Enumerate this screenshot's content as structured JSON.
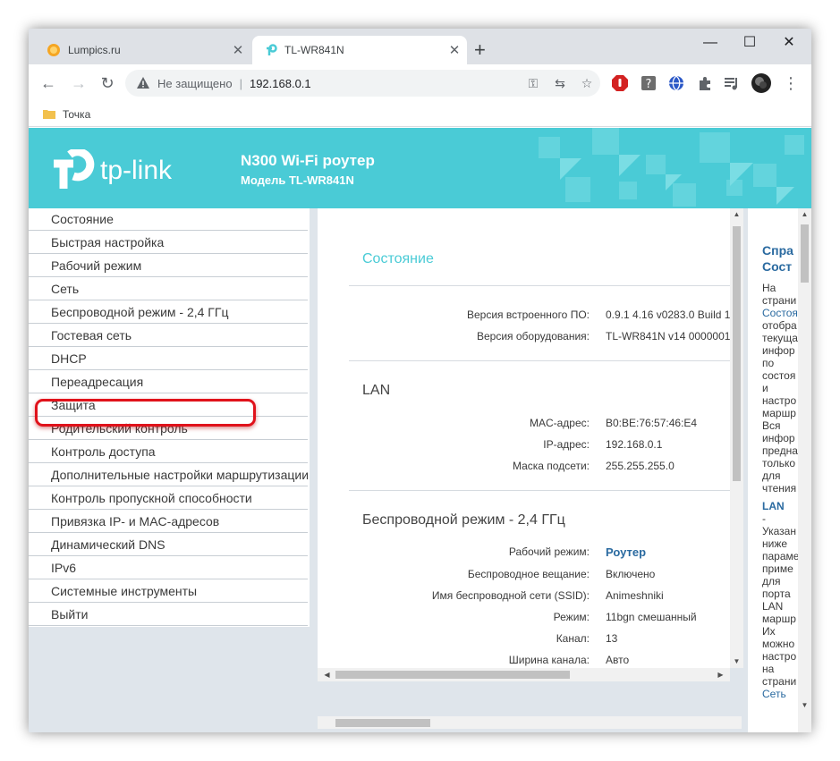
{
  "browser": {
    "tabs": [
      {
        "title": "Lumpics.ru",
        "close": "✕"
      },
      {
        "title": "TL-WR841N",
        "close": "✕"
      }
    ],
    "new_tab": "+",
    "window_controls": {
      "minimize": "—",
      "maximize": "☐",
      "close": "✕"
    },
    "nav": {
      "back": "←",
      "forward": "→",
      "reload": "↻"
    },
    "address": {
      "security": "Не защищено",
      "separator": "|",
      "url": "192.168.0.1"
    },
    "omni_icons": {
      "key": "⚿",
      "translate": "⇆",
      "star": "☆"
    },
    "menu_dots": "⋮",
    "bookmark": "Точка"
  },
  "router": {
    "logo": "tp-link",
    "product": "N300 Wi-Fi роутер",
    "model": "Модель TL-WR841N",
    "menu": [
      "Состояние",
      "Быстрая настройка",
      "Рабочий режим",
      "Сеть",
      "Беспроводной режим - 2,4 ГГц",
      "Гостевая сеть",
      "DHCP",
      "Переадресация",
      "Защита",
      "Родительский контроль",
      "Контроль доступа",
      "Дополнительные настройки маршрутизации",
      "Контроль пропускной способности",
      "Привязка IP- и MAC-адресов",
      "Динамический DNS",
      "IPv6",
      "Системные инструменты",
      "Выйти"
    ],
    "status": {
      "title": "Состояние",
      "rows": [
        {
          "label": "Версия встроенного ПО:",
          "value": "0.9.1 4.16 v0283.0 Build 1"
        },
        {
          "label": "Версия оборудования:",
          "value": "TL-WR841N v14 0000001"
        }
      ]
    },
    "lan": {
      "title": "LAN",
      "rows": [
        {
          "label": "MAC-адрес:",
          "value": "B0:BE:76:57:46:E4"
        },
        {
          "label": "IP-адрес:",
          "value": "192.168.0.1"
        },
        {
          "label": "Маска подсети:",
          "value": "255.255.255.0"
        }
      ]
    },
    "wireless": {
      "title": "Беспроводной режим - 2,4 ГГц",
      "rows": [
        {
          "label": "Рабочий режим:",
          "value": "Роутер"
        },
        {
          "label": "Беспроводное вещание:",
          "value": "Включено"
        },
        {
          "label": "Имя беспроводной сети (SSID):",
          "value": "Animeshniki"
        },
        {
          "label": "Режим:",
          "value": "11bgn смешанный"
        },
        {
          "label": "Канал:",
          "value": "13"
        },
        {
          "label": "Ширина канала:",
          "value": "Авто"
        }
      ]
    },
    "help": {
      "title1": "Спра",
      "title2": "Сост",
      "text1": "На\nстрани",
      "link1": "Состоя",
      "text2": "отобра\nтекуща\nинфор\nпо\nсостоя\nи\nнастро\nмаршр\nВся\nинфор\nпредна\nтолько\nдля\nчтения",
      "sub": "LAN",
      "text3": "-\nУказан\nниже\nпараме\nприме\nдля\nпорта\nLAN\nмаршр\nИх\nможно\nнастро\nна\nстрани",
      "link2": "Сеть"
    },
    "scroll_arrows": {
      "up": "▲",
      "down": "▼",
      "left": "◀",
      "right": "▶"
    }
  },
  "colors": {
    "accent": "#4acbd6",
    "link": "#2a6aa0",
    "highlight_ring": "#e0121b"
  }
}
